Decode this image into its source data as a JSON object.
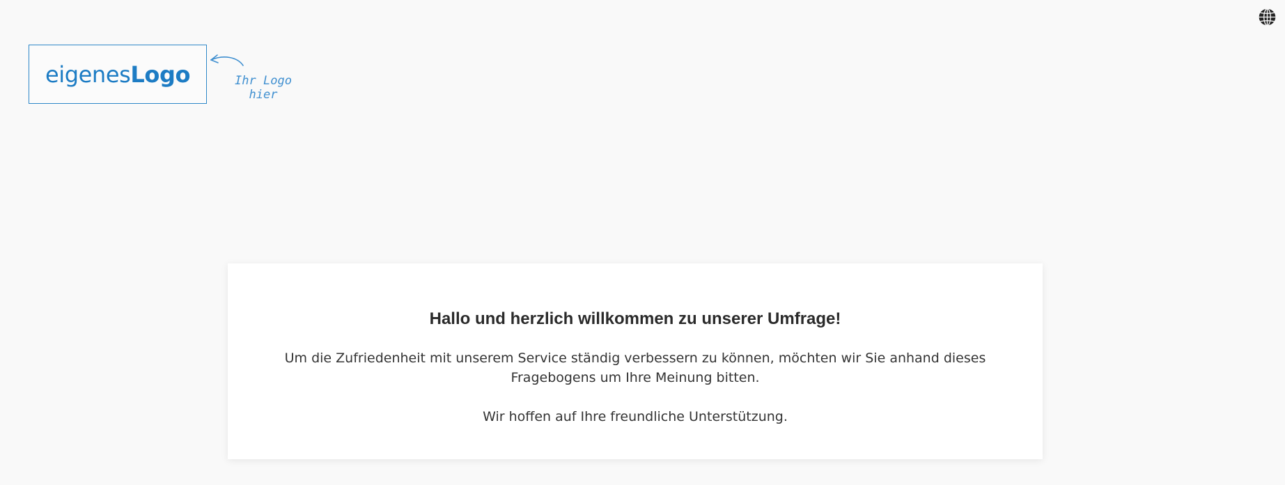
{
  "header": {
    "language_button": {
      "icon": "globe-icon",
      "color": "#222222"
    }
  },
  "logo": {
    "text_regular": "eigenes",
    "text_bold": "Logo",
    "note_line1": "Ihr Logo",
    "note_line2": "hier",
    "color": "#1d7cc4"
  },
  "welcome": {
    "title": "Hallo und herzlich willkommen zu unserer Umfrage!",
    "paragraph1": "Um die Zufriedenheit mit unserem Service ständig verbessern zu können, möchten wir Sie anhand dieses Fragebogens um Ihre Meinung bitten.",
    "paragraph2": "Wir hoffen auf Ihre freundliche Unterstützung."
  }
}
